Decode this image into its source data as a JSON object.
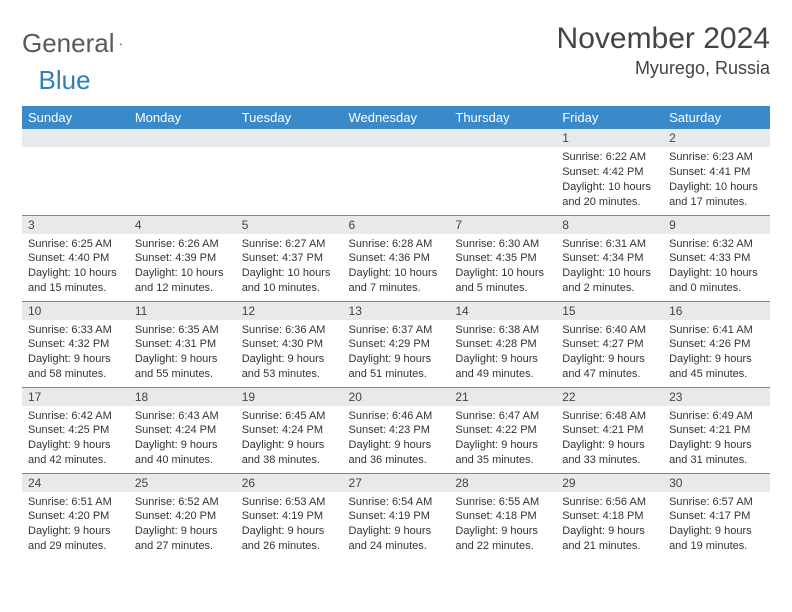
{
  "brand": {
    "part1": "General",
    "part2": "Blue"
  },
  "title": "November 2024",
  "location": "Myurego, Russia",
  "weekdays": [
    "Sunday",
    "Monday",
    "Tuesday",
    "Wednesday",
    "Thursday",
    "Friday",
    "Saturday"
  ],
  "days": [
    {
      "n": "1",
      "sr": "6:22 AM",
      "ss": "4:42 PM",
      "dl": "10 hours and 20 minutes."
    },
    {
      "n": "2",
      "sr": "6:23 AM",
      "ss": "4:41 PM",
      "dl": "10 hours and 17 minutes."
    },
    {
      "n": "3",
      "sr": "6:25 AM",
      "ss": "4:40 PM",
      "dl": "10 hours and 15 minutes."
    },
    {
      "n": "4",
      "sr": "6:26 AM",
      "ss": "4:39 PM",
      "dl": "10 hours and 12 minutes."
    },
    {
      "n": "5",
      "sr": "6:27 AM",
      "ss": "4:37 PM",
      "dl": "10 hours and 10 minutes."
    },
    {
      "n": "6",
      "sr": "6:28 AM",
      "ss": "4:36 PM",
      "dl": "10 hours and 7 minutes."
    },
    {
      "n": "7",
      "sr": "6:30 AM",
      "ss": "4:35 PM",
      "dl": "10 hours and 5 minutes."
    },
    {
      "n": "8",
      "sr": "6:31 AM",
      "ss": "4:34 PM",
      "dl": "10 hours and 2 minutes."
    },
    {
      "n": "9",
      "sr": "6:32 AM",
      "ss": "4:33 PM",
      "dl": "10 hours and 0 minutes."
    },
    {
      "n": "10",
      "sr": "6:33 AM",
      "ss": "4:32 PM",
      "dl": "9 hours and 58 minutes."
    },
    {
      "n": "11",
      "sr": "6:35 AM",
      "ss": "4:31 PM",
      "dl": "9 hours and 55 minutes."
    },
    {
      "n": "12",
      "sr": "6:36 AM",
      "ss": "4:30 PM",
      "dl": "9 hours and 53 minutes."
    },
    {
      "n": "13",
      "sr": "6:37 AM",
      "ss": "4:29 PM",
      "dl": "9 hours and 51 minutes."
    },
    {
      "n": "14",
      "sr": "6:38 AM",
      "ss": "4:28 PM",
      "dl": "9 hours and 49 minutes."
    },
    {
      "n": "15",
      "sr": "6:40 AM",
      "ss": "4:27 PM",
      "dl": "9 hours and 47 minutes."
    },
    {
      "n": "16",
      "sr": "6:41 AM",
      "ss": "4:26 PM",
      "dl": "9 hours and 45 minutes."
    },
    {
      "n": "17",
      "sr": "6:42 AM",
      "ss": "4:25 PM",
      "dl": "9 hours and 42 minutes."
    },
    {
      "n": "18",
      "sr": "6:43 AM",
      "ss": "4:24 PM",
      "dl": "9 hours and 40 minutes."
    },
    {
      "n": "19",
      "sr": "6:45 AM",
      "ss": "4:24 PM",
      "dl": "9 hours and 38 minutes."
    },
    {
      "n": "20",
      "sr": "6:46 AM",
      "ss": "4:23 PM",
      "dl": "9 hours and 36 minutes."
    },
    {
      "n": "21",
      "sr": "6:47 AM",
      "ss": "4:22 PM",
      "dl": "9 hours and 35 minutes."
    },
    {
      "n": "22",
      "sr": "6:48 AM",
      "ss": "4:21 PM",
      "dl": "9 hours and 33 minutes."
    },
    {
      "n": "23",
      "sr": "6:49 AM",
      "ss": "4:21 PM",
      "dl": "9 hours and 31 minutes."
    },
    {
      "n": "24",
      "sr": "6:51 AM",
      "ss": "4:20 PM",
      "dl": "9 hours and 29 minutes."
    },
    {
      "n": "25",
      "sr": "6:52 AM",
      "ss": "4:20 PM",
      "dl": "9 hours and 27 minutes."
    },
    {
      "n": "26",
      "sr": "6:53 AM",
      "ss": "4:19 PM",
      "dl": "9 hours and 26 minutes."
    },
    {
      "n": "27",
      "sr": "6:54 AM",
      "ss": "4:19 PM",
      "dl": "9 hours and 24 minutes."
    },
    {
      "n": "28",
      "sr": "6:55 AM",
      "ss": "4:18 PM",
      "dl": "9 hours and 22 minutes."
    },
    {
      "n": "29",
      "sr": "6:56 AM",
      "ss": "4:18 PM",
      "dl": "9 hours and 21 minutes."
    },
    {
      "n": "30",
      "sr": "6:57 AM",
      "ss": "4:17 PM",
      "dl": "9 hours and 19 minutes."
    }
  ],
  "labels": {
    "sunrise": "Sunrise: ",
    "sunset": "Sunset: ",
    "daylight": "Daylight: "
  },
  "first_weekday_index": 5
}
